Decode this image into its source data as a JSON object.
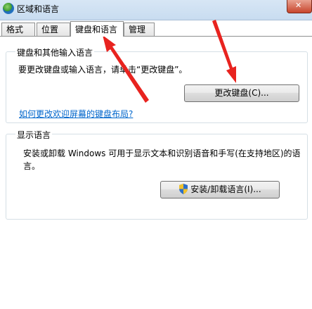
{
  "window": {
    "title": "区域和语言"
  },
  "tabs": [
    {
      "label": "格式",
      "active": false
    },
    {
      "label": "位置",
      "active": false
    },
    {
      "label": "键盘和语言",
      "active": true
    },
    {
      "label": "管理",
      "active": false
    }
  ],
  "keyboards_group": {
    "title": "键盘和其他输入语言",
    "description": "要更改键盘或输入语言，请单击“更改键盘”。",
    "change_button": "更改键盘(C)...",
    "help_link": "如何更改欢迎屏幕的键盘布局?"
  },
  "display_group": {
    "title": "显示语言",
    "description_line1": "安装或卸载 Windows 可用于显示文本和识别语音和手写(在支持地区)的语",
    "description_line2": "言。",
    "install_button": "安装/卸载语言(I)..."
  },
  "annotation_color": "#e8231f",
  "icons": {
    "title": "region-globe-icon",
    "close": "close-icon",
    "install": "uac-shield-icon"
  }
}
